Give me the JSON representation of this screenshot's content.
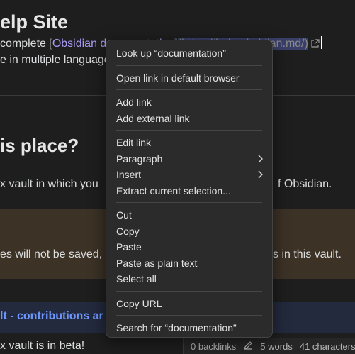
{
  "doc": {
    "heading1": "elp Site",
    "line1_prefix": "complete ",
    "line1_link_text": "Obsidian documentation",
    "line1_link_url": "(https://help.obsidian.md/)",
    "line2": "e in multiple languages",
    "heading2": "is place?",
    "para_left": "x vault in which you",
    "para_right": "f Obsidian.",
    "callout_left": "es will not be saved,",
    "callout_right": "s in this vault.",
    "callout2_title": "lt - contributions ar",
    "beta_line": "x vault is in beta!"
  },
  "context_menu": {
    "groups": [
      [
        {
          "label": "Look up “documentation”"
        }
      ],
      [
        {
          "label": "Open link in default browser"
        }
      ],
      [
        {
          "label": "Add link"
        },
        {
          "label": "Add external link"
        }
      ],
      [
        {
          "label": "Edit link"
        },
        {
          "label": "Paragraph",
          "submenu": true
        },
        {
          "label": "Insert",
          "submenu": true
        },
        {
          "label": "Extract current selection..."
        }
      ],
      [
        {
          "label": "Cut"
        },
        {
          "label": "Copy"
        },
        {
          "label": "Paste"
        },
        {
          "label": "Paste as plain text"
        },
        {
          "label": "Select all"
        }
      ],
      [
        {
          "label": "Copy URL"
        }
      ],
      [
        {
          "label": "Search for “documentation”"
        }
      ]
    ]
  },
  "status_bar": {
    "backlinks": "0 backlinks",
    "words": "5 words",
    "characters": "41 characters"
  },
  "colors": {
    "background": "#1e1e1e",
    "accent_link": "#a99bf5",
    "callout_warning": "#3c3226",
    "callout_info_title": "#6d97ff",
    "menu_bg": "#2b2b2b"
  }
}
